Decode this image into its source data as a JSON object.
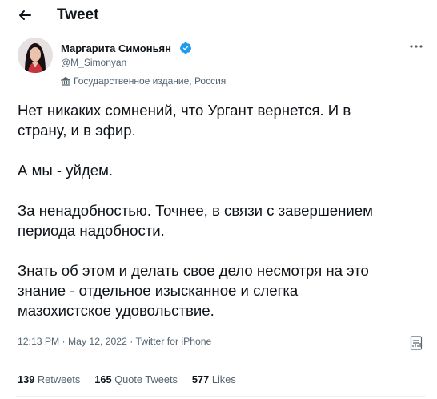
{
  "header": {
    "title": "Tweet",
    "back_icon": "arrow-left-icon"
  },
  "author": {
    "name": "Маргарита Симоньян",
    "handle": "@M_Simonyan",
    "label": "Государственное издание, Россия",
    "verified_icon": "verified-badge-icon",
    "label_icon": "state-media-flag-icon",
    "avatar_icon": "avatar-photo"
  },
  "tweet": {
    "lines": [
      "Нет никаких сомнений, что Ургант вернется. И в",
      "страну, и в эфир.",
      "",
      "А мы - уйдем.",
      "",
      "За ненадобностью. Точнее, в связи с завершением",
      "периода надобности.",
      "",
      "Знать об этом и делать свое дело несмотря на это",
      "знание - отдельное изысканное и слегка",
      "мазохистское удовольствие."
    ]
  },
  "meta": {
    "time": "12:13 PM",
    "sep1": " · ",
    "date": "May 12, 2022",
    "sep2": " · ",
    "source": "Twitter for iPhone"
  },
  "stats": {
    "retweets": {
      "count": "139",
      "label": "Retweets"
    },
    "quotes": {
      "count": "165",
      "label": "Quote Tweets"
    },
    "likes": {
      "count": "577",
      "label": "Likes"
    }
  },
  "colors": {
    "verified": "#1d9bf0",
    "secondary_text": "#536471",
    "primary_text": "#0f1419",
    "divider": "#eff3f4"
  }
}
